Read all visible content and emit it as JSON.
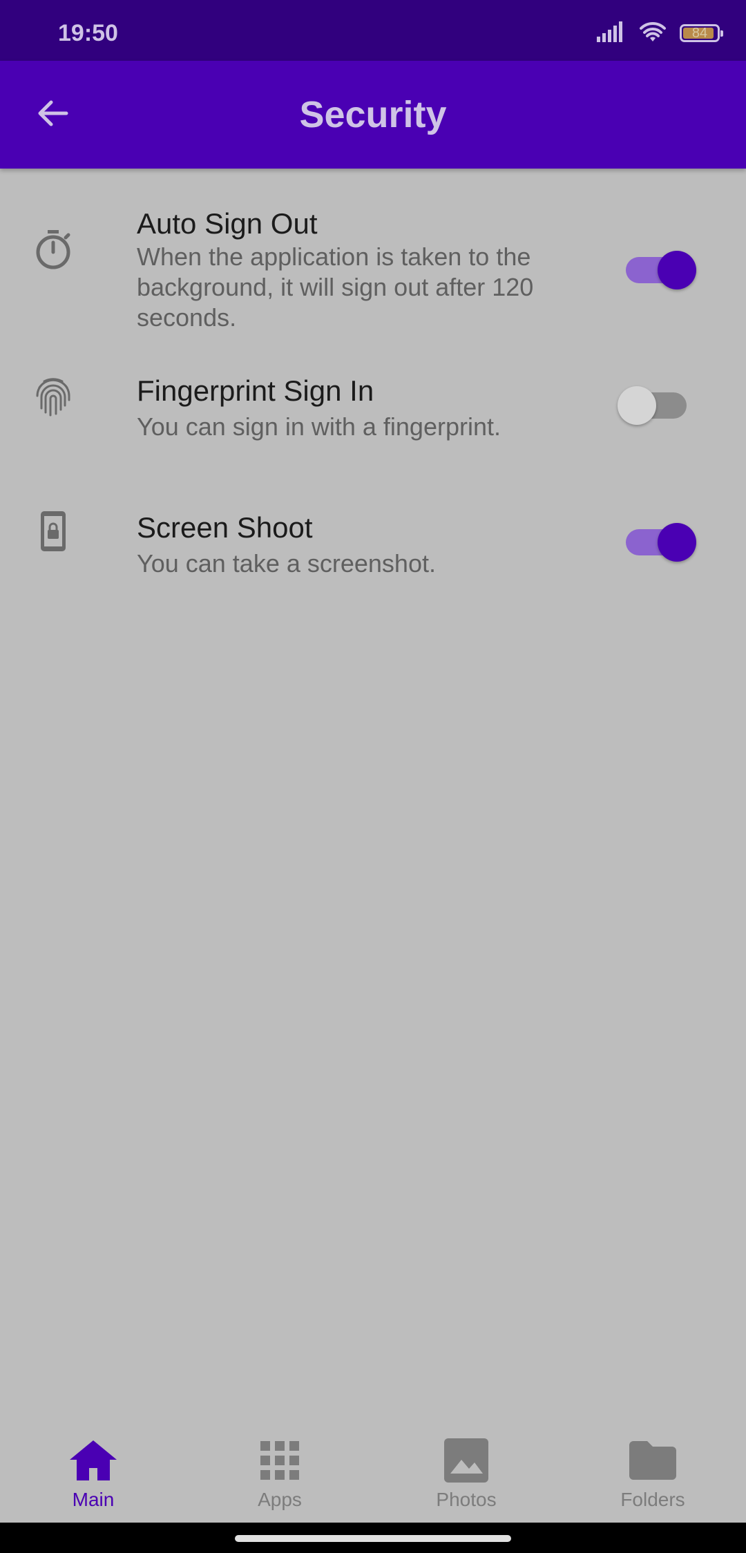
{
  "status_bar": {
    "time": "19:50",
    "battery_level": "84",
    "icons": [
      "signal-icon",
      "wifi-icon",
      "battery-icon"
    ]
  },
  "app_bar": {
    "title": "Security",
    "back_icon": "arrow-back-icon"
  },
  "settings": [
    {
      "icon": "timer-icon",
      "title": "Auto Sign Out",
      "description": "When the application is taken to the background, it will sign out after 120 seconds.",
      "enabled": true
    },
    {
      "icon": "fingerprint-icon",
      "title": "Fingerprint Sign In",
      "description": "You can sign in with a fingerprint.",
      "enabled": false
    },
    {
      "icon": "phone-lock-icon",
      "title": "Screen Shoot",
      "description": "You can take a screenshot.",
      "enabled": true
    }
  ],
  "bottom_nav": {
    "items": [
      {
        "label": "Main",
        "icon": "home-icon",
        "active": true
      },
      {
        "label": "Apps",
        "icon": "apps-grid-icon",
        "active": false
      },
      {
        "label": "Photos",
        "icon": "image-icon",
        "active": false
      },
      {
        "label": "Folders",
        "icon": "folder-icon",
        "active": false
      }
    ]
  },
  "colors": {
    "status_bar": "#31007e",
    "app_bar": "#4a00b3",
    "accent": "#4a00b3",
    "background": "#bdbdbd"
  }
}
